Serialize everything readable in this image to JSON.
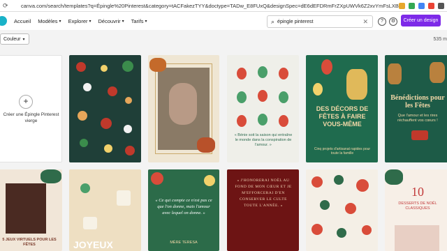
{
  "browser": {
    "url": "canva.com/search/templates?q=Épingle%20Pinterest&category=tACFakezTYY&doctype=TADw_E8FUxQ&designSpec=dE6dEFDRmFrZXpUWVk6Z2xvYmFsLXBpbnR..."
  },
  "header": {
    "nav": [
      "Accueil",
      "Modèles",
      "Explorer",
      "Découvrir",
      "Tarifs"
    ],
    "search_value": "épingle pinterest",
    "create_label": "Créer un design"
  },
  "filter": {
    "label": "Couleur"
  },
  "results_count": "535 m",
  "blank_card": {
    "label": "Créer une Épingle Pinterest vierge"
  },
  "cards": {
    "ornaments_caption": "« Bénie soit la saison qui entraîne le monde dans la conspiration de l'amour. »",
    "decor_title": "DES DÉCORS DE FÊTES À FAIRE VOUS-MÊME",
    "decor_sub": "Cinq projets d'artisanat rapides pour toute la famille",
    "benedictions_title": "Bénédictions pour les Fêtes",
    "benedictions_sub": "Que l'amour et les rires réchauffent vos cœurs !",
    "joueux_label": "5 JEUX VIRTUELS POUR LES FÊTES",
    "joyeux_title": "JOYEUX",
    "quote_text": "« Ce qui compte ce n'est pas ce que l'on donne, mais l'amour avec lequel on donne. »",
    "quote_author": "MÈRE TERESA",
    "noel_text": "« J'HONORERAI NOËL AU FOND DE MON CŒUR ET JE M'EFFORCERAI D'EN CONSERVER LE CULTE TOUTE L'ANNÉE. »",
    "dix_number": "10",
    "dix_title": "DESSERTS DE NOËL CLASSIQUES"
  }
}
